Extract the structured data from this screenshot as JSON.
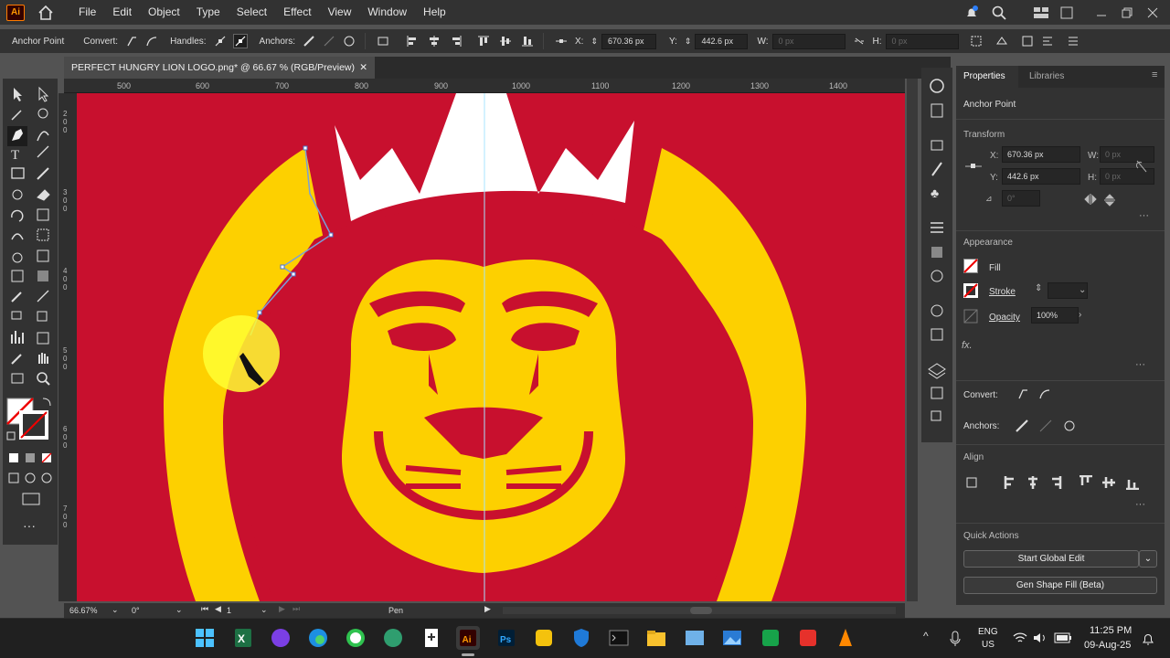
{
  "app": {
    "logo": "Ai"
  },
  "menu": [
    "File",
    "Edit",
    "Object",
    "Type",
    "Select",
    "Effect",
    "View",
    "Window",
    "Help"
  ],
  "control_bar": {
    "context": "Anchor Point",
    "convert_label": "Convert:",
    "handles_label": "Handles:",
    "anchors_label": "Anchors:",
    "x_label": "X:",
    "x_value": "670.36 px",
    "y_label": "Y:",
    "y_value": "442.6 px",
    "w_label": "W:",
    "w_value": "0 px",
    "h_label": "H:",
    "h_value": "0 px"
  },
  "document": {
    "tab_title": "PERFECT HUNGRY LION LOGO.png* @ 66.67 % (RGB/Preview)",
    "close": "✕"
  },
  "ruler": {
    "h_ticks": [
      "500",
      "600",
      "700",
      "800",
      "900",
      "1000",
      "1100",
      "1200",
      "1300",
      "1400"
    ],
    "v_ticks": [
      "200",
      "300",
      "400",
      "500",
      "600",
      "700"
    ]
  },
  "status": {
    "zoom": "66.67%",
    "rotation": "0°",
    "artboard": "1",
    "tool": "Pen"
  },
  "properties": {
    "tabs": [
      "Properties",
      "Libraries"
    ],
    "selection": "Anchor Point",
    "transform_header": "Transform",
    "x_label": "X:",
    "x_value": "670.36 px",
    "y_label": "Y:",
    "y_value": "442.6 px",
    "w_label": "W:",
    "w_value": "0 px",
    "h_label": "H:",
    "h_value": "0 px",
    "angle_value": "0°",
    "appearance_header": "Appearance",
    "fill_label": "Fill",
    "stroke_label": "Stroke",
    "opacity_label": "Opacity",
    "opacity_value": "100%",
    "fx_label": "fx.",
    "convert_label": "Convert:",
    "anchors_label": "Anchors:",
    "align_header": "Align",
    "quick_actions_header": "Quick Actions",
    "btn_global_edit": "Start Global Edit",
    "btn_gen_shape": "Gen Shape Fill (Beta)"
  },
  "taskbar": {
    "lang1": "ENG",
    "lang2": "US",
    "time": "11:25 PM",
    "date": "09-Aug-25"
  },
  "colors": {
    "artboard_red": "#c8102e",
    "lion_yellow": "#fdd000",
    "ui_dark": "#323232",
    "accent_orange": "#ff9a00"
  },
  "icons": [
    "home-icon",
    "bell-icon",
    "search-icon",
    "arrange-icon",
    "minimize-icon",
    "maximize-icon",
    "close-icon",
    "selection-tool-icon",
    "direct-selection-tool-icon",
    "pen-tool-icon",
    "type-tool-icon",
    "rectangle-tool-icon",
    "hand-tool-icon",
    "zoom-tool-icon",
    "wifi-icon",
    "volume-icon",
    "battery-icon"
  ]
}
